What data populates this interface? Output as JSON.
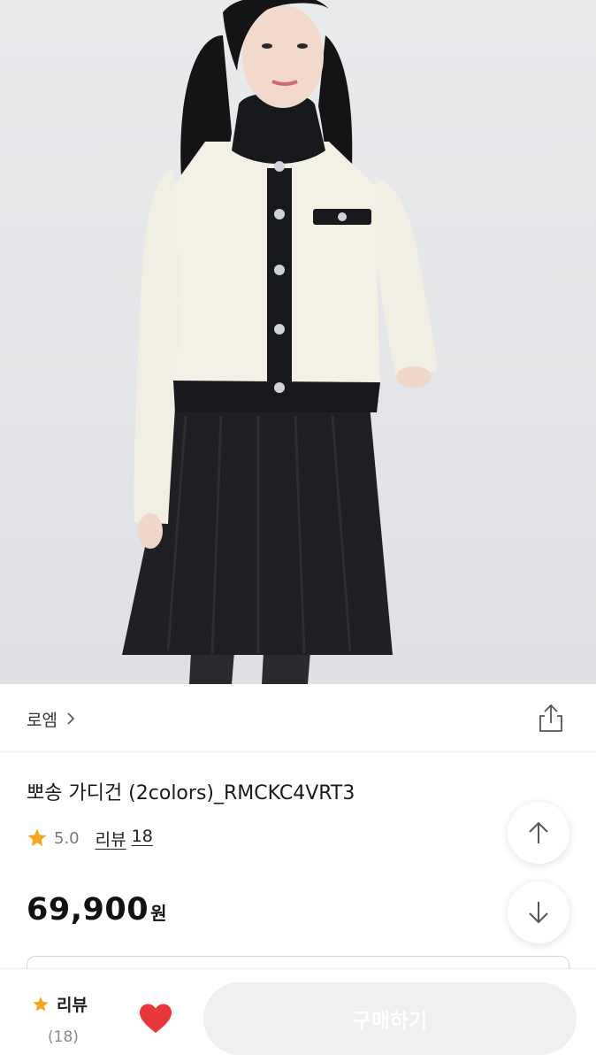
{
  "brand": {
    "name": "로엠"
  },
  "product": {
    "title": "뽀송 가디건 (2colors)_RMCKC4VRT3",
    "rating": "5.0",
    "review_label": "리뷰",
    "review_count": "18",
    "price": "69,900",
    "currency": "원"
  },
  "bottom_bar": {
    "review_label": "리뷰",
    "review_count": "(18)",
    "buy_label": "구매하기"
  },
  "icons": {
    "brand_chevron": "chevron-right-icon",
    "share": "share-icon",
    "rating_star": "star-icon",
    "scroll_up": "arrow-up-icon",
    "scroll_down": "arrow-down-icon",
    "wishlist": "heart-icon"
  },
  "colors": {
    "star": "#f5a623",
    "heart": "#e8383d",
    "buy_button_bg": "#f0f0f0",
    "buy_button_text": "#ffffff"
  }
}
